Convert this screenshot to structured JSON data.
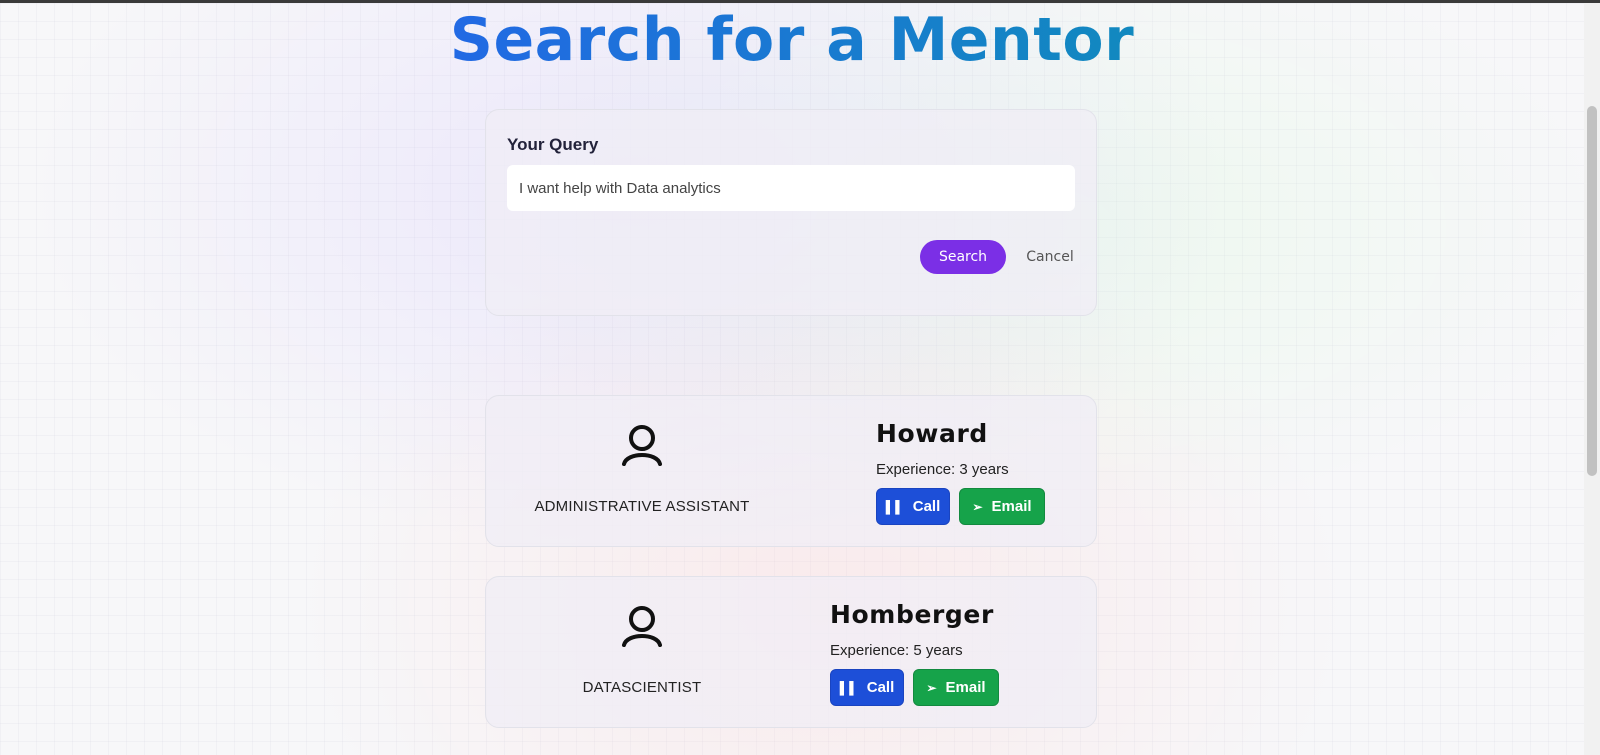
{
  "page": {
    "title": "Search for a Mentor"
  },
  "query": {
    "label": "Your Query",
    "value": "I want help with Data analytics",
    "placeholder": "I want help with Data analytics",
    "search_label": "Search",
    "cancel_label": "Cancel"
  },
  "mentors": [
    {
      "name": "Howard",
      "role": "ADMINISTRATIVE ASSISTANT",
      "experience": "Experience: 3 years",
      "call_label": "Call",
      "email_label": "Email",
      "avatar_icon": "user-avatar-icon"
    },
    {
      "name": "Homberger",
      "role": "DATASCIENTIST",
      "experience": "Experience: 5 years",
      "call_label": "Call",
      "email_label": "Email",
      "avatar_icon": "user-avatar-icon"
    }
  ],
  "colors": {
    "title_gradient_start": "#2563eb",
    "title_gradient_end": "#0e8fb8",
    "search_button": "#7b2fe6",
    "call_button": "#1d4fd8",
    "email_button": "#16a34a"
  }
}
